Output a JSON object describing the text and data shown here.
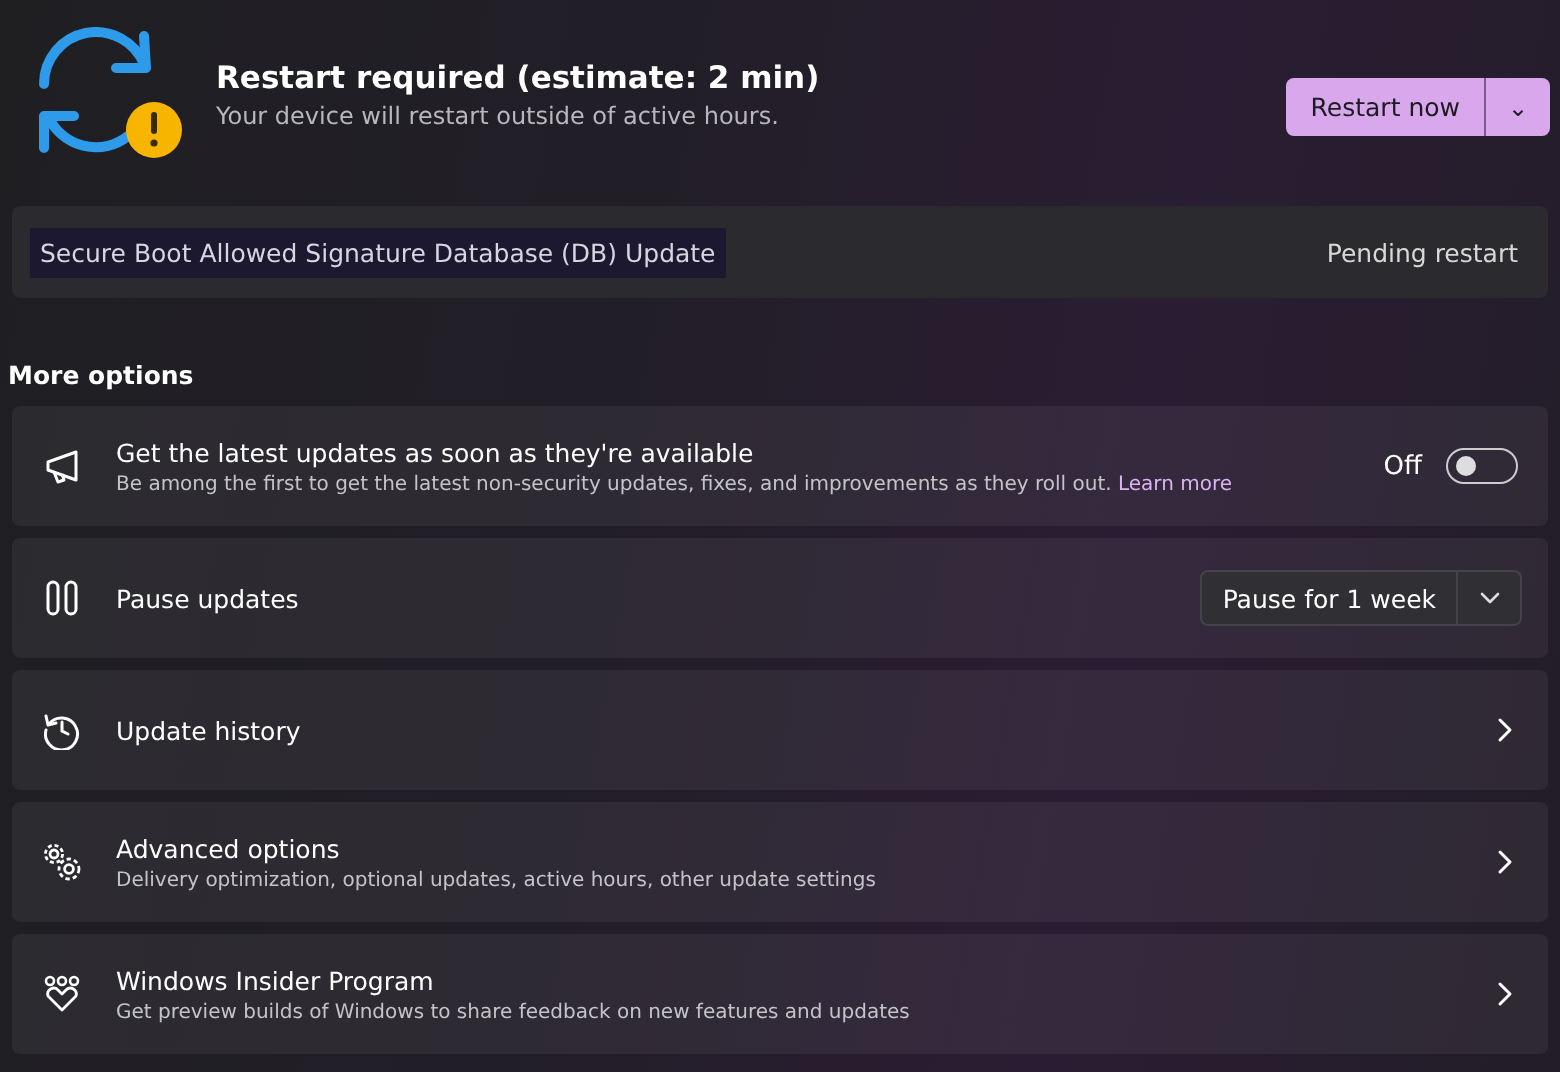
{
  "status": {
    "title": "Restart required (estimate: 2 min)",
    "subtitle": "Your device will restart outside of active hours.",
    "primary_button": "Restart now",
    "menu_button": "⌄"
  },
  "updates": [
    {
      "name": "Secure Boot Allowed Signature Database (DB) Update",
      "highlighted": true,
      "status": "Pending restart"
    }
  ],
  "section_title": "More options",
  "options": [
    {
      "kind": "toggle",
      "title": "Get the latest updates as soon as they're available",
      "description": "Be among the first to get the latest non-security updates, fixes, and improvements as they roll out.",
      "link": "Learn more",
      "state_label": "Off",
      "on": false
    },
    {
      "kind": "dropdown",
      "title": "Pause updates",
      "value": "Pause for 1 week"
    },
    {
      "kind": "link",
      "title": "Update history"
    },
    {
      "kind": "link",
      "title": "Advanced options",
      "description": "Delivery optimization, optional updates, active hours, other update settings"
    },
    {
      "kind": "link",
      "title": "Windows Insider Program",
      "description": "Get preview builds of Windows to share feedback on new features and updates"
    }
  ]
}
